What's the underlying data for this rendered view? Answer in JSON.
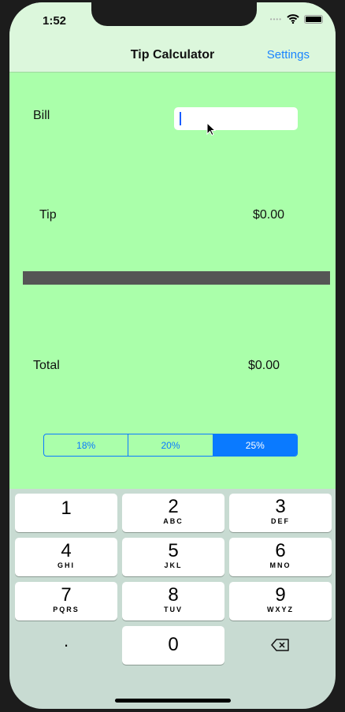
{
  "status": {
    "time": "1:52"
  },
  "nav": {
    "title": "Tip Calculator",
    "settings_label": "Settings"
  },
  "bill": {
    "label": "Bill",
    "value": ""
  },
  "tip": {
    "label": "Tip",
    "value": "$0.00"
  },
  "total": {
    "label": "Total",
    "value": "$0.00"
  },
  "tip_options": {
    "options": [
      "18%",
      "20%",
      "25%"
    ],
    "selected": "25%"
  },
  "keypad": {
    "keys": [
      {
        "n": "1",
        "s": ""
      },
      {
        "n": "2",
        "s": "ABC"
      },
      {
        "n": "3",
        "s": "DEF"
      },
      {
        "n": "4",
        "s": "GHI"
      },
      {
        "n": "5",
        "s": "JKL"
      },
      {
        "n": "6",
        "s": "MNO"
      },
      {
        "n": "7",
        "s": "PQRS"
      },
      {
        "n": "8",
        "s": "TUV"
      },
      {
        "n": "9",
        "s": "WXYZ"
      }
    ],
    "decimal": ".",
    "zero": "0"
  }
}
